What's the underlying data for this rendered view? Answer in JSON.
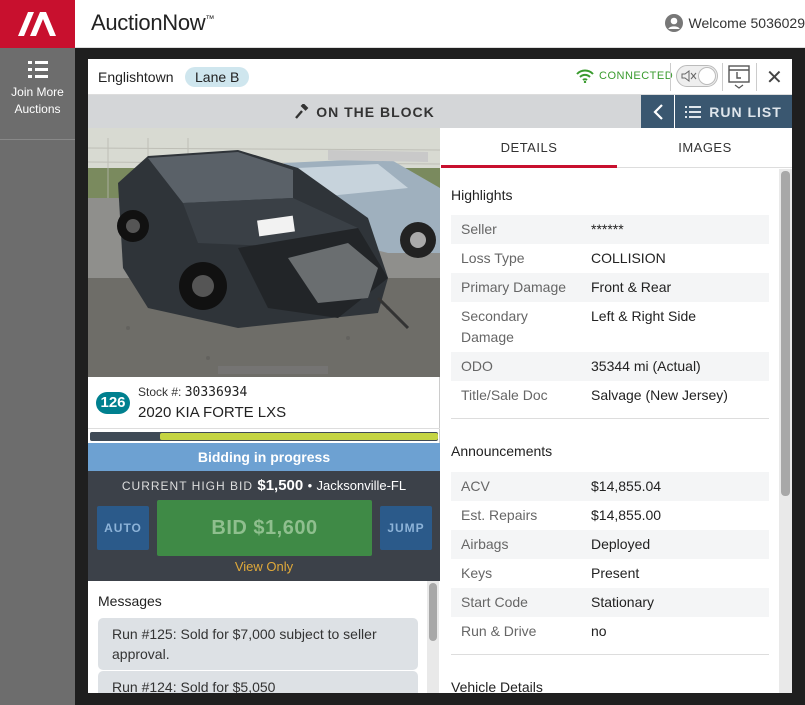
{
  "app": {
    "brand": "AuctionNow",
    "brand_mark": "™",
    "welcome": "Welcome 5036029"
  },
  "sidebar": {
    "join_label_1": "Join More",
    "join_label_2": "Auctions"
  },
  "header": {
    "location": "Englishtown",
    "lane": "Lane B",
    "connection": "CONNECTED",
    "close": "✕"
  },
  "block": {
    "label": "ON THE BLOCK",
    "runlist": "RUN LIST"
  },
  "vehicle": {
    "run_number": "126",
    "stock_label": "Stock #:",
    "stock_number": "30336934",
    "title": "2020 KIA FORTE LXS",
    "progress": 0.8
  },
  "bidding": {
    "status": "Bidding in progress",
    "current_label": "CURRENT HIGH BID",
    "current_amount": "$1,500",
    "location_sep": "•",
    "location": "Jacksonville-FL",
    "auto": "AUTO",
    "bid": "BID $1,600",
    "jump": "JUMP",
    "view_only": "View Only"
  },
  "messages": {
    "title": "Messages",
    "items": [
      "Run #125: Sold for $7,000 subject to seller approval.",
      "Run #124: Sold for $5,050"
    ]
  },
  "tabs": {
    "details": "DETAILS",
    "images": "IMAGES"
  },
  "details": {
    "highlights_title": "Highlights",
    "highlights": [
      {
        "k": "Seller",
        "v": "******"
      },
      {
        "k": "Loss Type",
        "v": "COLLISION"
      },
      {
        "k": "Primary Damage",
        "v": "Front & Rear"
      },
      {
        "k": "Secondary Damage",
        "v": "Left & Right Side"
      },
      {
        "k": "ODO",
        "v": "35344 mi (Actual)"
      },
      {
        "k": "Title/Sale Doc",
        "v": "Salvage (New Jersey)"
      }
    ],
    "announcements_title": "Announcements",
    "announcements": [
      {
        "k": "ACV",
        "v": "$14,855.04"
      },
      {
        "k": "Est. Repairs",
        "v": "$14,855.00"
      },
      {
        "k": "Airbags",
        "v": "Deployed"
      },
      {
        "k": "Keys",
        "v": "Present"
      },
      {
        "k": "Start Code",
        "v": "Stationary"
      },
      {
        "k": "Run & Drive",
        "v": "no"
      }
    ],
    "vehicle_details_title": "Vehicle Details"
  }
}
